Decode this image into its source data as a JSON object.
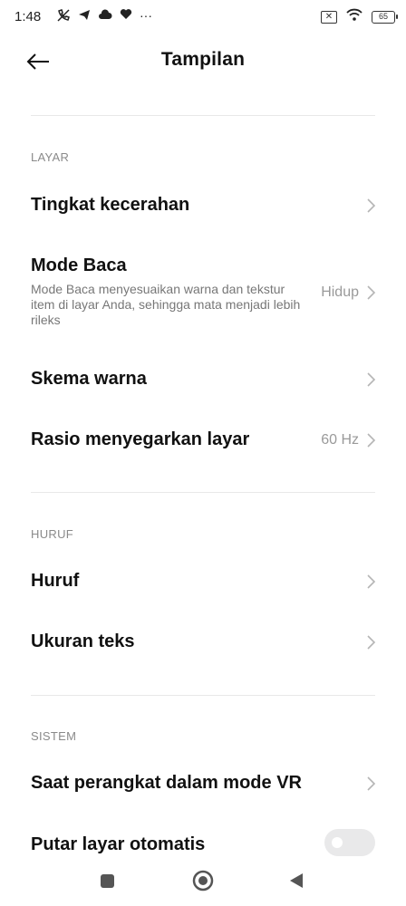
{
  "status_bar": {
    "time": "1:48",
    "battery_level": "65",
    "icons_left": [
      "muted-call-icon",
      "telegram-icon",
      "cloud-icon",
      "heart-icon",
      "more-dots-icon"
    ],
    "icons_right": [
      "no-sim-icon",
      "wifi-icon",
      "battery-icon"
    ],
    "more_dots": "···"
  },
  "header": {
    "title": "Tampilan",
    "back_icon": "arrow-left-icon"
  },
  "sections": {
    "layar": {
      "label": "LAYAR",
      "items": [
        {
          "title": "Tingkat kecerahan",
          "value": ""
        },
        {
          "title": "Mode Baca",
          "description": "Mode Baca menyesuaikan warna dan tekstur item di layar Anda, sehingga mata menjadi lebih rileks",
          "value": "Hidup"
        },
        {
          "title": "Skema warna",
          "value": ""
        },
        {
          "title": "Rasio menyegarkan layar",
          "value": "60 Hz"
        }
      ]
    },
    "huruf": {
      "label": "HURUF",
      "items": [
        {
          "title": "Huruf",
          "value": ""
        },
        {
          "title": "Ukuran teks",
          "value": ""
        }
      ]
    },
    "sistem": {
      "label": "SISTEM",
      "items": [
        {
          "title": "Saat perangkat dalam mode VR",
          "value": ""
        },
        {
          "title": "Putar layar otomatis",
          "toggle_on": false
        }
      ]
    }
  },
  "nav_bar": {
    "buttons": [
      "recents-square-icon",
      "home-circle-icon",
      "back-triangle-icon"
    ]
  },
  "colors": {
    "background": "#ffffff",
    "text_primary": "#111111",
    "text_secondary": "#777777",
    "section_label": "#8a8a8a",
    "chevron": "#b5b5b5",
    "toggle_off": "#e9e9ea"
  }
}
